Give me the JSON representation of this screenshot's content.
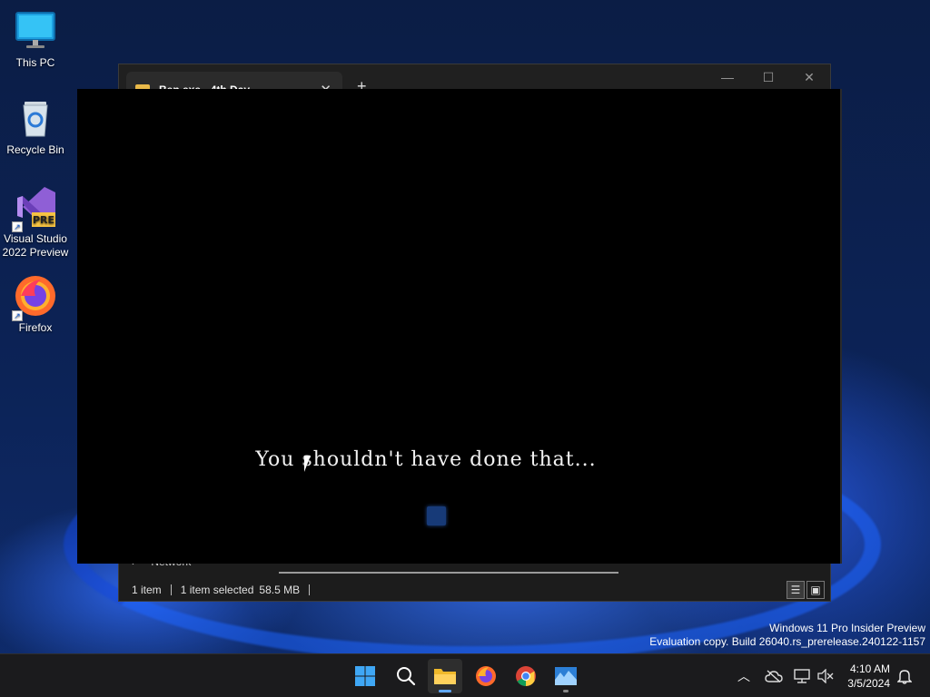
{
  "desktop": {
    "icons": [
      {
        "label": "This PC",
        "icon": "monitor-icon"
      },
      {
        "label": "Recycle Bin",
        "icon": "recycle-bin-icon"
      },
      {
        "label": "Visual Studio 2022 Preview",
        "icon": "visual-studio-icon",
        "badge": "PRE"
      },
      {
        "label": "Firefox",
        "icon": "firefox-icon"
      }
    ]
  },
  "explorer": {
    "tab_title": "Ben.exe - 4th Day",
    "tab_close": "✕",
    "new_tab": "+",
    "controls": {
      "minimize": "—",
      "maximize": "☐",
      "close": "✕"
    },
    "nav_item": "Network",
    "status": {
      "items": "1 item",
      "selected": "1 item selected",
      "size": "58.5 MB"
    }
  },
  "game": {
    "message": "You shouldn't have done that..."
  },
  "watermark": {
    "line1": "Windows 11 Pro Insider Preview",
    "line2": "Evaluation copy. Build 26040.rs_prerelease.240122-1157"
  },
  "taskbar": {
    "apps": [
      "start-icon",
      "search-icon",
      "file-explorer-icon",
      "firefox-icon",
      "chrome-icon",
      "game-app-icon"
    ],
    "time": "4:10 AM",
    "date": "3/5/2024",
    "tray": [
      "chevron-up-icon",
      "cloud-off-icon",
      "network-icon",
      "volume-muted-icon",
      "notification-bell-icon"
    ]
  },
  "colors": {
    "accent": "#60a8ff",
    "folder": "#e9b949",
    "cube": "#173a78"
  }
}
